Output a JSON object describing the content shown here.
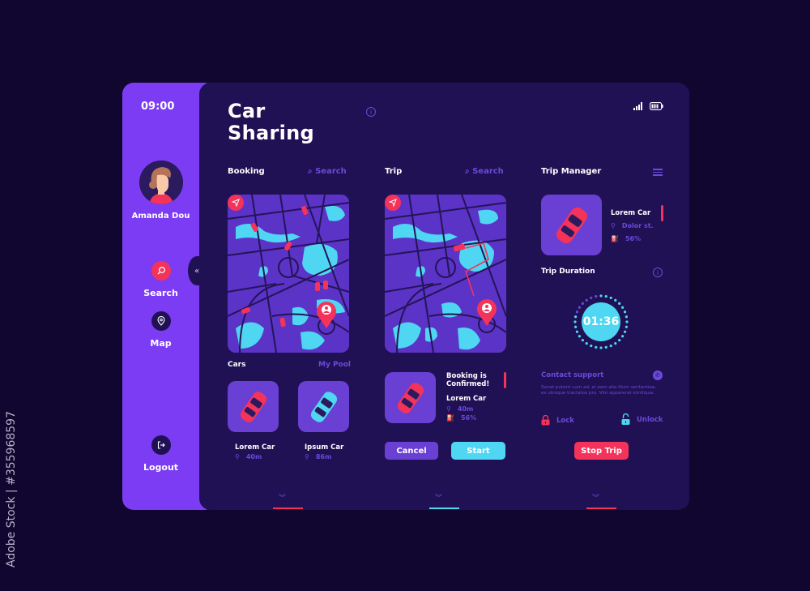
{
  "watermark": "Adobe Stock | #355968597",
  "sidebar": {
    "time": "09:00",
    "user_name": "Amanda Dou",
    "nav": [
      {
        "label": "Search",
        "icon": "search-icon"
      },
      {
        "label": "Map",
        "icon": "map-pin-icon"
      },
      {
        "label": "Logout",
        "icon": "logout-icon"
      }
    ],
    "collapse_glyph": "«"
  },
  "header": {
    "title_line1": "Car",
    "title_line2": "Sharing",
    "info_glyph": "i"
  },
  "booking": {
    "heading": "Booking",
    "search_label": "Search",
    "cars_heading": "Cars",
    "pool_link": "My Pool",
    "cars": [
      {
        "name": "Lorem Car",
        "distance": "40m",
        "color": "#f4335a"
      },
      {
        "name": "Ipsum Car",
        "distance": "86m",
        "color": "#4fd6f2"
      }
    ]
  },
  "trip": {
    "heading": "Trip",
    "search_label": "Search",
    "confirm_title_1": "Booking is",
    "confirm_title_2": "Confirmed!",
    "car_name": "Lorem Car",
    "distance": "40m",
    "fuel": "56%",
    "cancel_label": "Cancel",
    "start_label": "Start"
  },
  "manager": {
    "heading": "Trip Manager",
    "car_name": "Lorem Car",
    "location": "Dolor st.",
    "fuel": "56%",
    "duration_heading": "Trip Duration",
    "duration": "01:36",
    "duration_progress": 0.8,
    "support_title": "Contact support",
    "support_text": "Sonet putent cum ad, ei eam alia illum sententiae, ex utroque tractatos pro. Vim apparerat similique.",
    "lock_label": "Lock",
    "unlock_label": "Unlock",
    "stop_label": "Stop Trip"
  },
  "colors": {
    "accent_red": "#f4335a",
    "accent_cyan": "#4fd6f2",
    "sidebar_purple": "#7b3cf4",
    "panel_bg": "#201154",
    "muted_purple": "#6a4ad8"
  }
}
